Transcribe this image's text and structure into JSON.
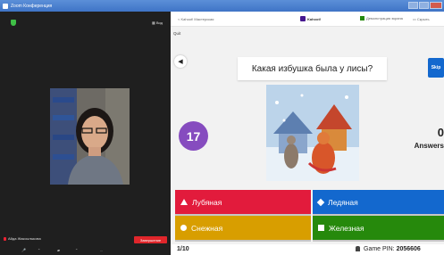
{
  "window": {
    "title": "Zoom Конференция"
  },
  "zoom": {
    "view_label": "Вид",
    "participant_name": "Айда Жаксылыкова",
    "end_button": "Завершение",
    "toolbar_more": "..."
  },
  "kahoot": {
    "top": {
      "back_label": "< Kahoot! Мастерская",
      "logo_label": "Kahoot!",
      "fullscreen_label": "Демонстрация экрана",
      "hide_label": "Скрыть"
    },
    "quit_label": "Quit",
    "question": "Какая избушка была у лисы?",
    "skip_label": "Skip",
    "timer": "17",
    "answers_count": "0",
    "answers_label": "Answers",
    "answers": [
      {
        "label": "Лубяная",
        "shape": "triangle",
        "color": "#e21b3c"
      },
      {
        "label": "Ледяная",
        "shape": "diamond",
        "color": "#1368ce"
      },
      {
        "label": "Снежная",
        "shape": "circle",
        "color": "#d89e00"
      },
      {
        "label": "Железная",
        "shape": "square",
        "color": "#26890c"
      }
    ],
    "footer": {
      "progress": "1/10",
      "game_pin_label": "Game PIN:",
      "game_pin_value": "2056606"
    }
  }
}
